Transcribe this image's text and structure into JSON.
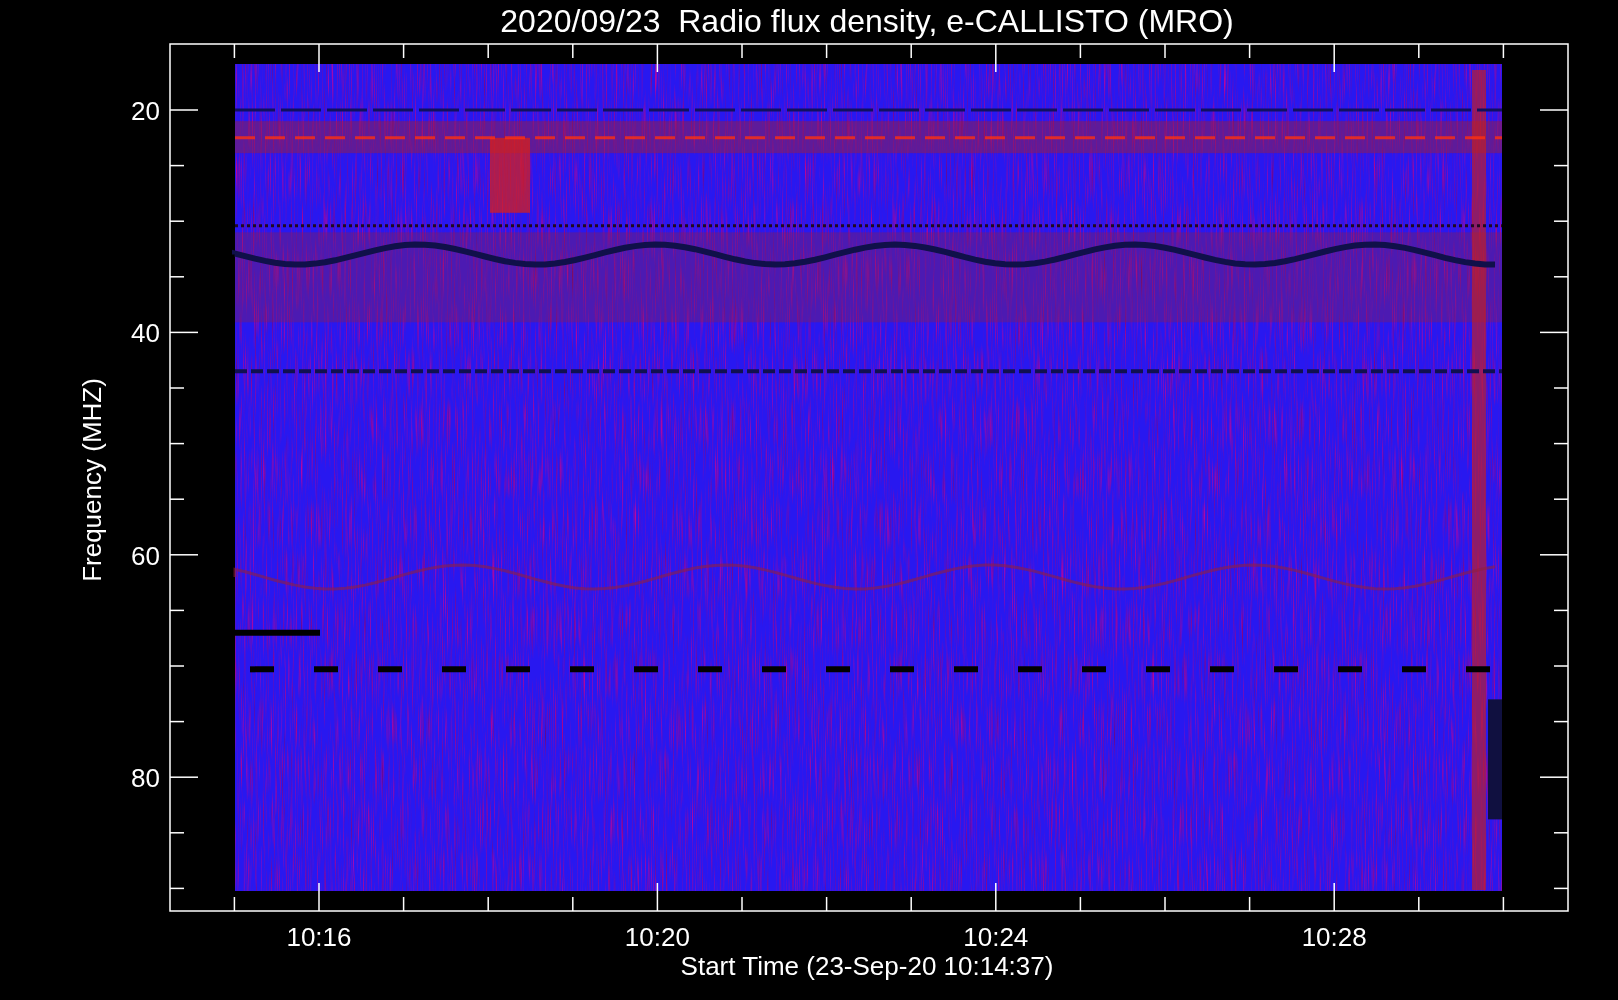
{
  "title": "2020/09/23  Radio flux density, e-CALLISTO (MRO)",
  "y_axis": {
    "label": "Frequency (MHZ)",
    "tick_labels": [
      "20",
      "40",
      "60",
      "80"
    ]
  },
  "x_axis": {
    "label": "Start Time (23-Sep-20 10:14:37)",
    "tick_labels": [
      "10:16",
      "10:20",
      "10:24",
      "10:28"
    ]
  }
}
